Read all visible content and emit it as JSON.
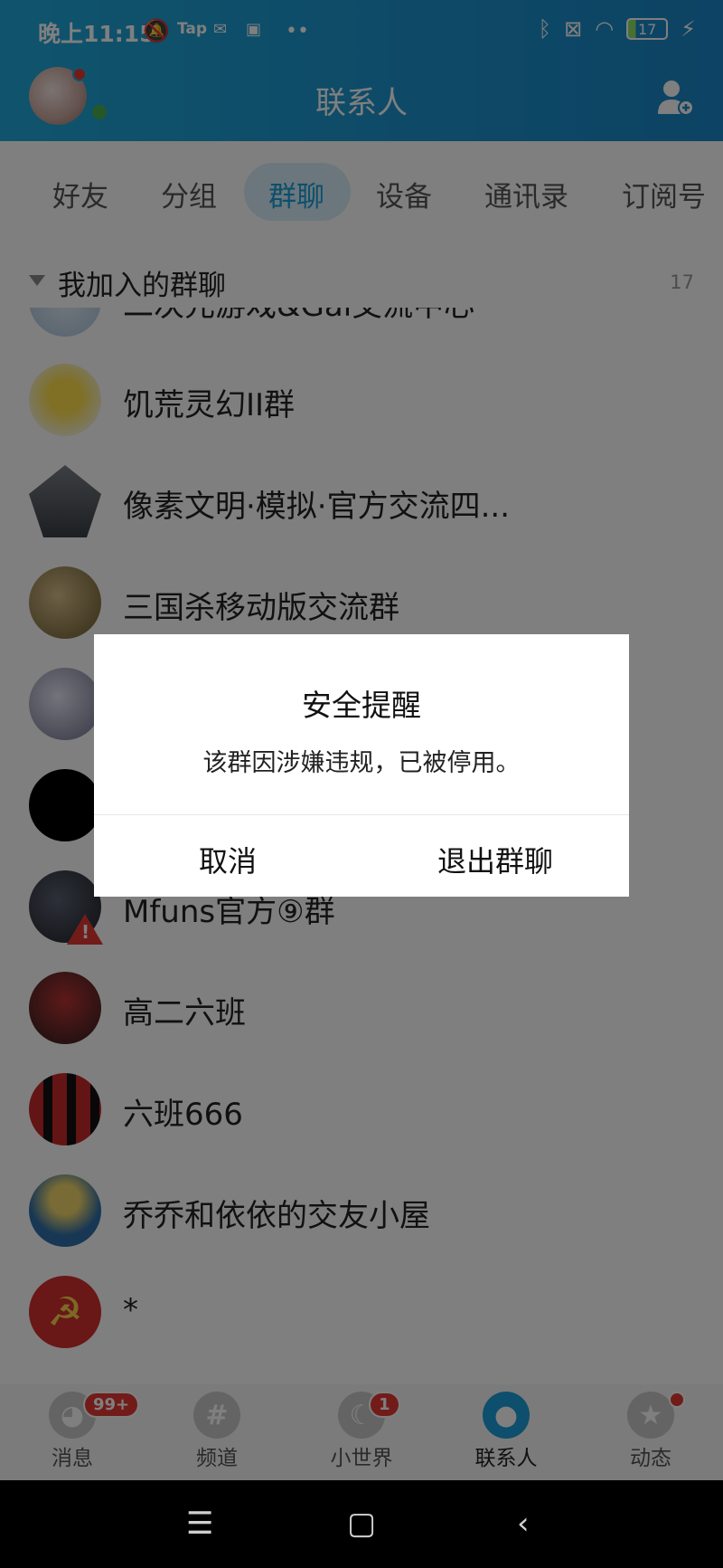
{
  "status_bar": {
    "time": "晚上11:15",
    "icons": [
      "mute-icon",
      "tap-icon",
      "mail-icon",
      "mi-icon",
      "more-dots-icon"
    ],
    "right_icons": [
      "bluetooth-icon",
      "sim-off-icon",
      "wifi-icon"
    ],
    "battery": "17"
  },
  "header": {
    "title": "联系人"
  },
  "tabs": [
    {
      "label": "好友"
    },
    {
      "label": "分组"
    },
    {
      "label": "群聊",
      "active": true
    },
    {
      "label": "设备"
    },
    {
      "label": "通讯录"
    },
    {
      "label": "订阅号"
    }
  ],
  "section": {
    "title": "我加入的群聊",
    "count": "17"
  },
  "groups": [
    {
      "name": "二次元游戏&Gal交流中心"
    },
    {
      "name": "饥荒灵幻II群"
    },
    {
      "name": "像素文明·模拟·官方交流四..."
    },
    {
      "name": "三国杀移动版交流群"
    },
    {
      "name": ""
    },
    {
      "name": ""
    },
    {
      "name": "Mfuns官方⑨群"
    },
    {
      "name": "高二六班"
    },
    {
      "name": "六班666"
    },
    {
      "name": "乔乔和依依的交友小屋"
    },
    {
      "name": "*"
    }
  ],
  "dialog": {
    "title": "安全提醒",
    "message": "该群因涉嫌违规，已被停用。",
    "cancel": "取消",
    "confirm": "退出群聊"
  },
  "bottom_nav": [
    {
      "label": "消息",
      "badge": "99+"
    },
    {
      "label": "频道"
    },
    {
      "label": "小世界",
      "badge": "1"
    },
    {
      "label": "联系人",
      "active": true
    },
    {
      "label": "动态",
      "dot": true
    }
  ],
  "colors": {
    "accent": "#1a9ed8",
    "header": "#1a86c8",
    "badge": "#e53935"
  }
}
